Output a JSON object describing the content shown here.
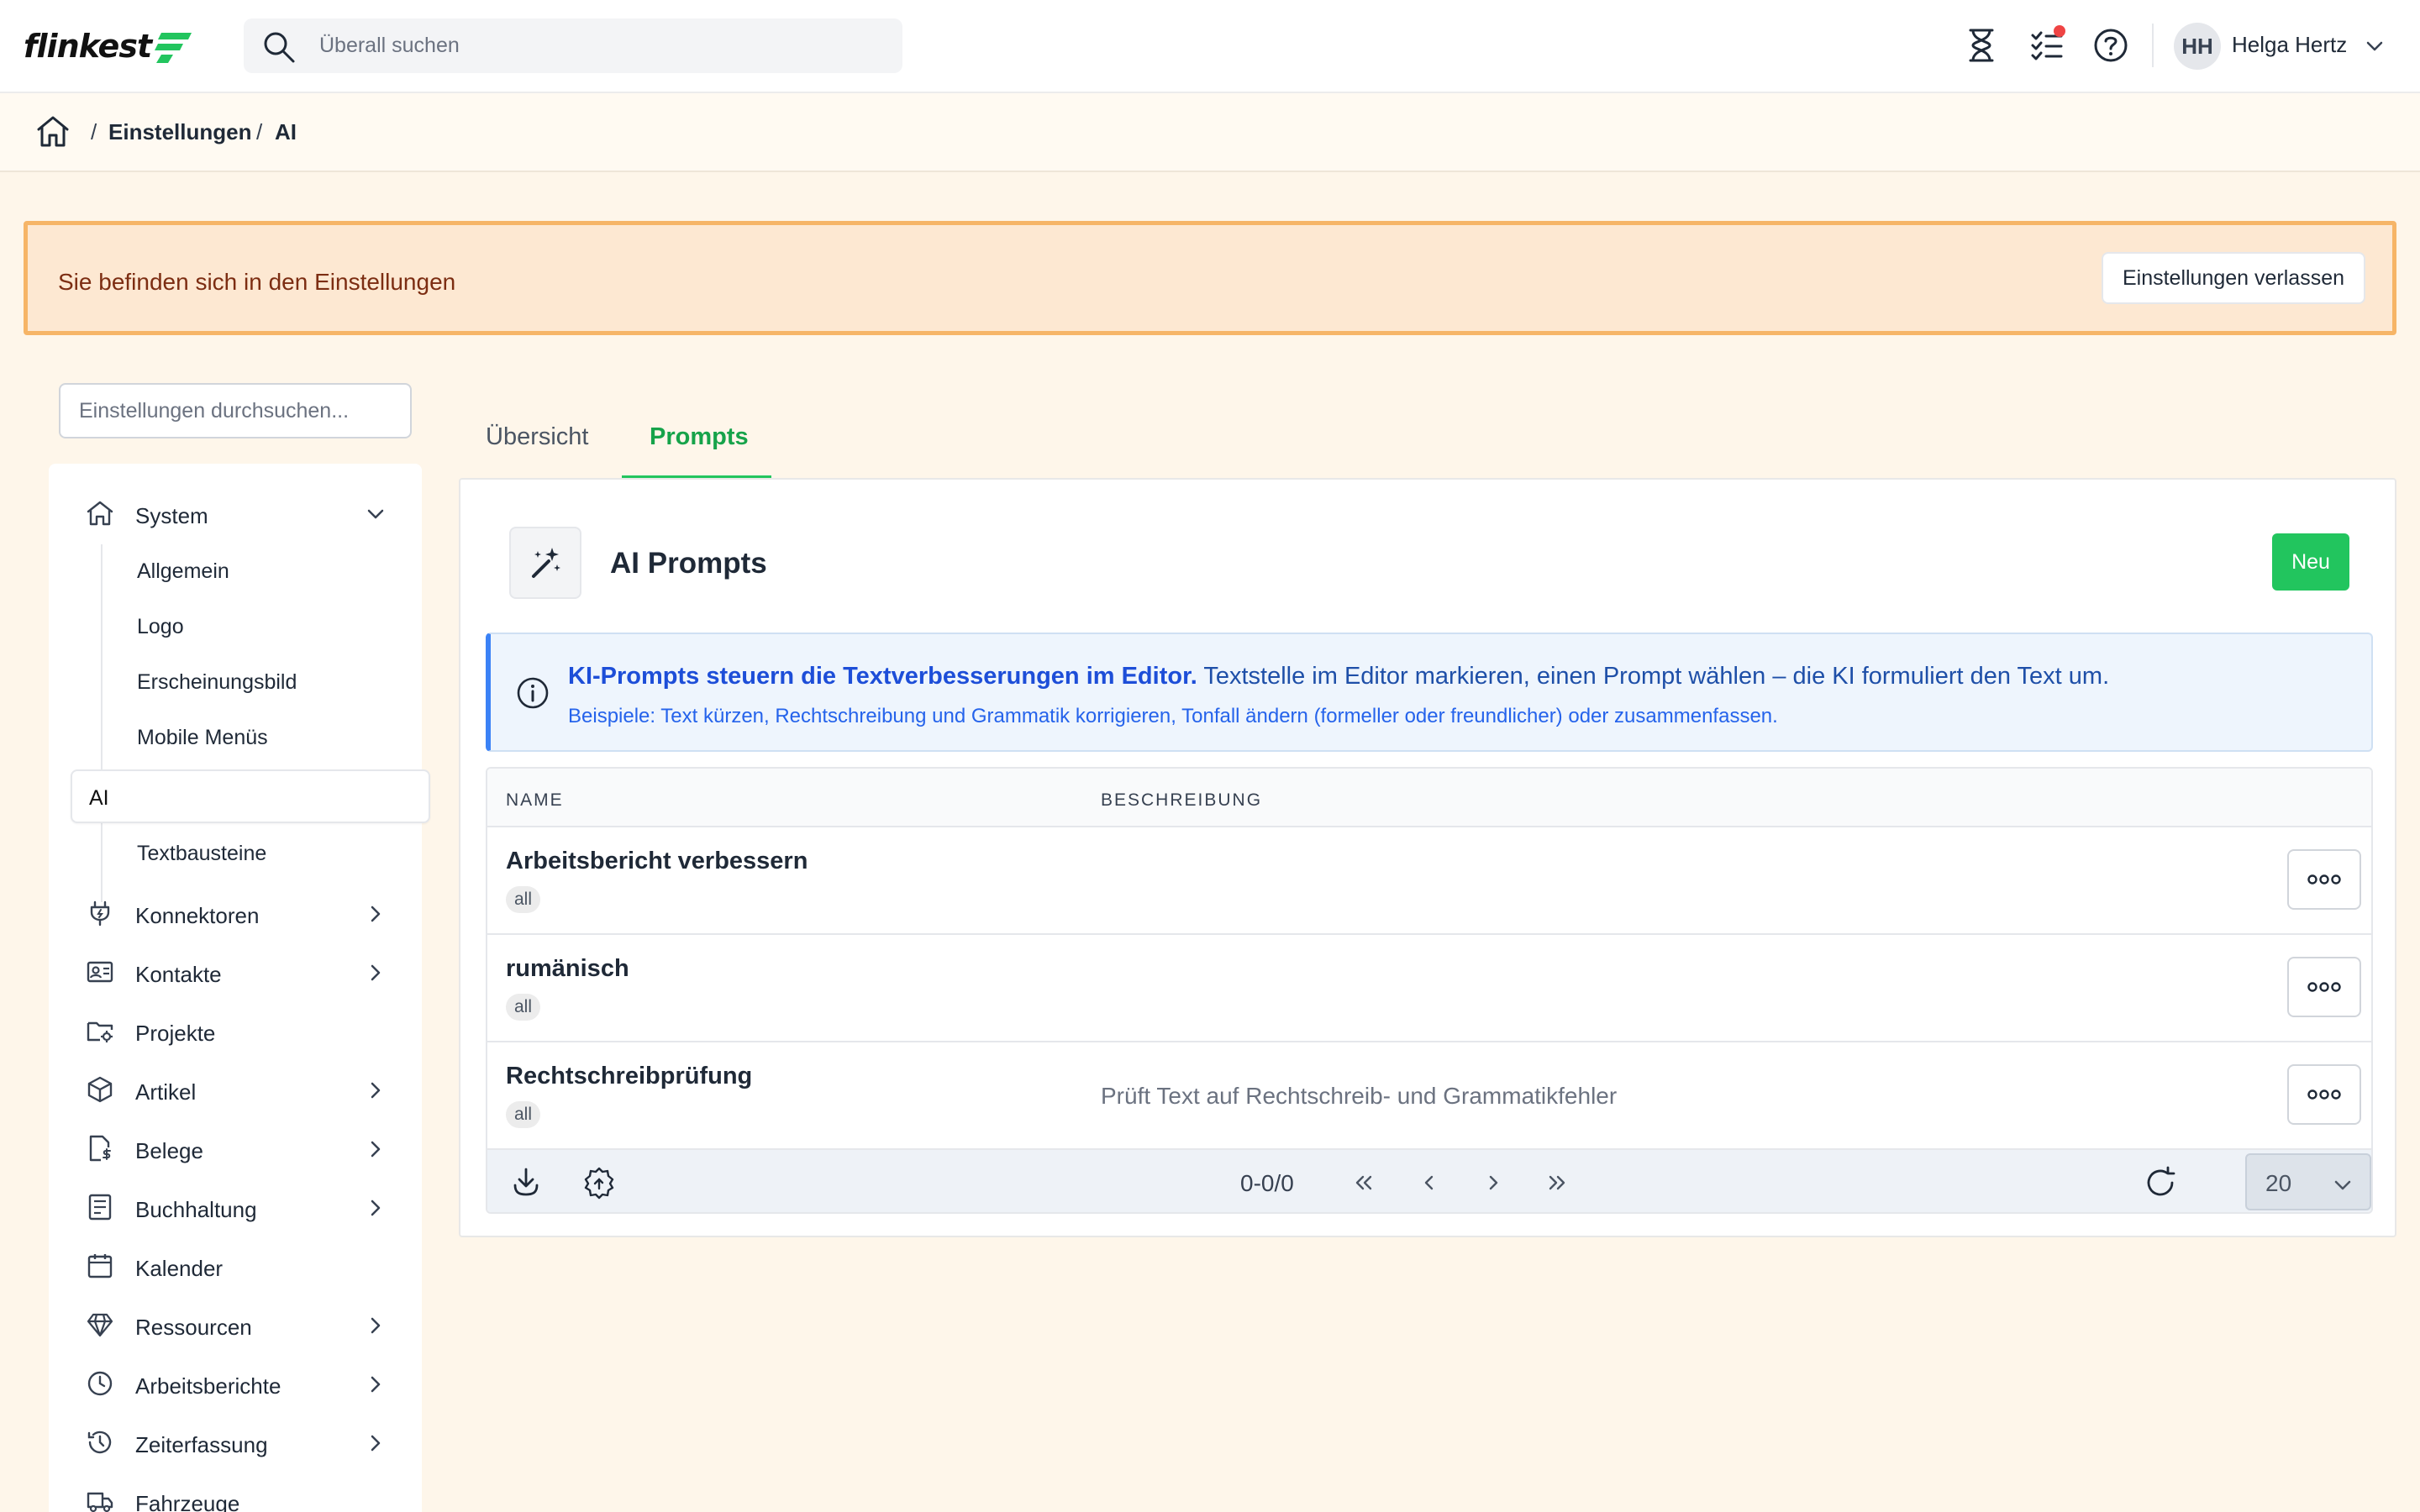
{
  "brand": {
    "logo_text": "flinkest"
  },
  "search": {
    "placeholder": "Überall suchen"
  },
  "user": {
    "initials": "HH",
    "name": "Helga Hertz"
  },
  "breadcrumb": {
    "items": [
      "Einstellungen",
      "AI"
    ]
  },
  "banner": {
    "text": "Sie befinden sich in den Einstellungen",
    "leave_label": "Einstellungen verlassen"
  },
  "settings_search": {
    "placeholder": "Einstellungen durchsuchen..."
  },
  "sidebar": {
    "system_label": "System",
    "system_children": [
      "Allgemein",
      "Logo",
      "Erscheinungsbild",
      "Mobile Menüs",
      "AI",
      "Textbausteine"
    ],
    "items": [
      {
        "label": "Konnektoren",
        "icon": "plug-icon",
        "expandable": true
      },
      {
        "label": "Kontakte",
        "icon": "contact-card-icon",
        "expandable": true
      },
      {
        "label": "Projekte",
        "icon": "folder-gear-icon",
        "expandable": false
      },
      {
        "label": "Artikel",
        "icon": "box-icon",
        "expandable": true
      },
      {
        "label": "Belege",
        "icon": "document-dollar-icon",
        "expandable": true
      },
      {
        "label": "Buchhaltung",
        "icon": "ledger-icon",
        "expandable": true
      },
      {
        "label": "Kalender",
        "icon": "calendar-icon",
        "expandable": false
      },
      {
        "label": "Ressourcen",
        "icon": "diamond-icon",
        "expandable": true
      },
      {
        "label": "Arbeitsberichte",
        "icon": "clock-icon",
        "expandable": true
      },
      {
        "label": "Zeiterfassung",
        "icon": "clock-history-icon",
        "expandable": true
      },
      {
        "label": "Fahrzeuge",
        "icon": "truck-icon",
        "expandable": false
      }
    ]
  },
  "tabs": {
    "overview": "Übersicht",
    "prompts": "Prompts"
  },
  "panel": {
    "title": "AI Prompts",
    "new_label": "Neu",
    "info_bold": "KI-Prompts steuern die Textverbesserungen im Editor.",
    "info_rest": " Textstelle im Editor markieren, einen Prompt wählen – die KI formuliert den Text um.",
    "info_examples": "Beispiele: Text kürzen, Rechtschreibung und Grammatik korrigieren, Tonfall ändern (formeller oder freundlicher) oder zusammenfassen."
  },
  "table": {
    "columns": {
      "name": "NAME",
      "description": "BESCHREIBUNG"
    },
    "rows": [
      {
        "name": "Arbeitsbericht verbessern",
        "badge": "all",
        "description": ""
      },
      {
        "name": "rumänisch",
        "badge": "all",
        "description": ""
      },
      {
        "name": "Rechtschreibprüfung",
        "badge": "all",
        "description": "Prüft Text auf Rechtschreib- und Grammatikfehler"
      }
    ],
    "pager_info": "0-0/0",
    "page_size": "20"
  },
  "colors": {
    "accent": "#22c55e",
    "banner_border": "#f6b567",
    "info_accent": "#3b82f6"
  }
}
